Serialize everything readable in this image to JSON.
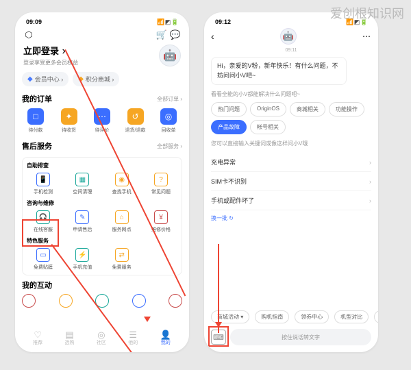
{
  "watermark": "爱创根知识网",
  "phone1": {
    "status": {
      "time": "09:09",
      "icons_l": "⚙ ⚬ ◧ ⚬",
      "icons_r": "📶 ◩ 🔋"
    },
    "topbar": {
      "settings": "⬡",
      "cart": "🛒",
      "chat": "💬"
    },
    "login": {
      "title": "立即登录",
      "arrow": "›",
      "sub": "登录享受更多会员权益"
    },
    "avatar_face": "🤖",
    "pills": [
      {
        "icon": "◆",
        "text": "会员中心 ›"
      },
      {
        "icon": "◆",
        "text": "积分商城 ›"
      }
    ],
    "orders": {
      "title": "我的订单",
      "more": "全部订单 ›",
      "items": [
        {
          "bg": "#3b6eff",
          "glyph": "□",
          "label": "待付款"
        },
        {
          "bg": "#f6a623",
          "glyph": "✦",
          "label": "待收货"
        },
        {
          "bg": "#3b6eff",
          "glyph": "⋯",
          "label": "待评价"
        },
        {
          "bg": "#f6a623",
          "glyph": "↺",
          "label": "退货/退款"
        },
        {
          "bg": "#3b6eff",
          "glyph": "◎",
          "label": "回收单"
        }
      ]
    },
    "after": {
      "title": "售后服务",
      "more": "全部服务 ›"
    },
    "self": {
      "title": "自助排查",
      "items": [
        {
          "c": "#3b6eff",
          "g": "📱",
          "label": "手机检测"
        },
        {
          "c": "#1aa89a",
          "g": "▦",
          "label": "空间清理"
        },
        {
          "c": "#f6a623",
          "g": "◉",
          "label": "查找手机"
        },
        {
          "c": "#f6a623",
          "g": "?",
          "label": "常见问题"
        }
      ]
    },
    "consult": {
      "title": "咨询与维修",
      "items": [
        {
          "c": "#1aa89a",
          "g": "🎧",
          "label": "在线客服"
        },
        {
          "c": "#3b6eff",
          "g": "✎",
          "label": "申请售后"
        },
        {
          "c": "#f6a623",
          "g": "⌂",
          "label": "服务网点"
        },
        {
          "c": "#c84b4b",
          "g": "¥",
          "label": "维修价格"
        }
      ]
    },
    "special": {
      "title": "特色服务",
      "items": [
        {
          "c": "#3b6eff",
          "g": "▭",
          "label": "免费贴膜"
        },
        {
          "c": "#1aa89a",
          "g": "⚡",
          "label": "手机充值"
        },
        {
          "c": "#f6a623",
          "g": "⇄",
          "label": "免费服务"
        }
      ]
    },
    "interact": {
      "title": "我的互动"
    },
    "tabs": [
      {
        "i": "♡",
        "t": "推荐"
      },
      {
        "i": "▤",
        "t": "选购"
      },
      {
        "i": "◎",
        "t": "社区"
      },
      {
        "i": "☰",
        "t": "他的"
      },
      {
        "i": "👤",
        "t": "我的"
      }
    ]
  },
  "phone2": {
    "status": {
      "time": "09:12",
      "icons_l": "⚙ ⚬ ◧ ⚬",
      "icons_r": "📶 ◩ 🔋"
    },
    "ts": "09:11",
    "bubble": "Hi，亲爱的V粉，新年快乐！有什么问题，不妨问问小V吧~",
    "hint1": "看看全能的小V都能解决什么问题吧~",
    "chips": [
      "热门问题",
      "OriginOS",
      "商城相关",
      "功能操作",
      "产品故障",
      "帐号相关"
    ],
    "chip_active": 4,
    "hint2": "您可以直接输入关键词或像这样问小V哦",
    "faq": [
      "充电异常",
      "SIM卡不识别",
      "手机或配件坏了"
    ],
    "refresh": "换一批 ↻",
    "strip": [
      "商城活动 ▾",
      "购机指南",
      "领券中心",
      "机型对比",
      "以"
    ],
    "kbd": "⌨",
    "voice": "按住说话转文字"
  }
}
